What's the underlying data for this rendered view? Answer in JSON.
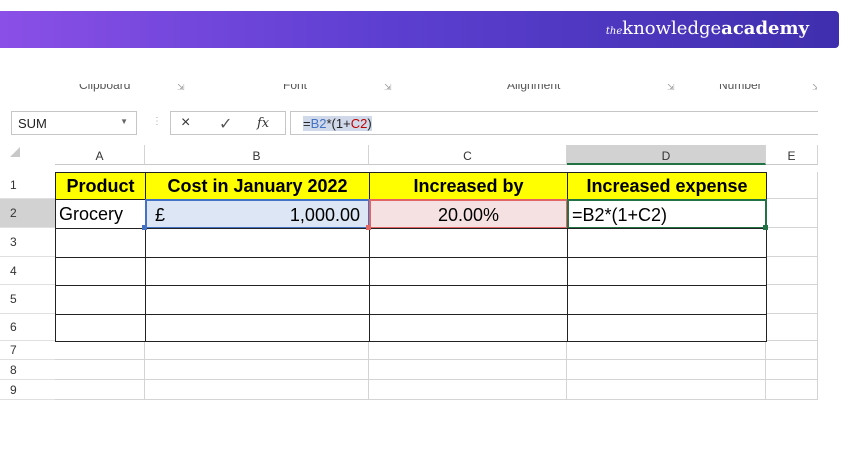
{
  "brand": {
    "prefix": "the",
    "part1": "knowledge",
    "part2": "academy"
  },
  "ribbon": {
    "groups": [
      "Clipboard",
      "Font",
      "Alignment",
      "Number"
    ]
  },
  "formula_bar": {
    "name_box": "SUM",
    "cancel_icon": "×",
    "enter_icon": "✓",
    "fx_label": "fx",
    "formula_eq": "=",
    "formula_b2": "B2",
    "formula_mid": "*(1+",
    "formula_c2": "C2",
    "formula_end": ")"
  },
  "columns": [
    "A",
    "B",
    "C",
    "D",
    "E"
  ],
  "rows": [
    "1",
    "2",
    "3",
    "4",
    "5",
    "6",
    "7",
    "8",
    "9"
  ],
  "table": {
    "headers": {
      "A": "Product",
      "B": "Cost in January 2022",
      "C": "Increased by",
      "D": "Increased expense"
    },
    "row2": {
      "A": "Grocery",
      "B_currency": "£",
      "B_value": "1,000.00",
      "C": "20.00%",
      "D": "=B2*(1+C2)"
    }
  },
  "colors": {
    "header_fill": "#ffff00",
    "b_ref": "#4472c4",
    "c_ref": "#c00000",
    "active": "#217346"
  }
}
